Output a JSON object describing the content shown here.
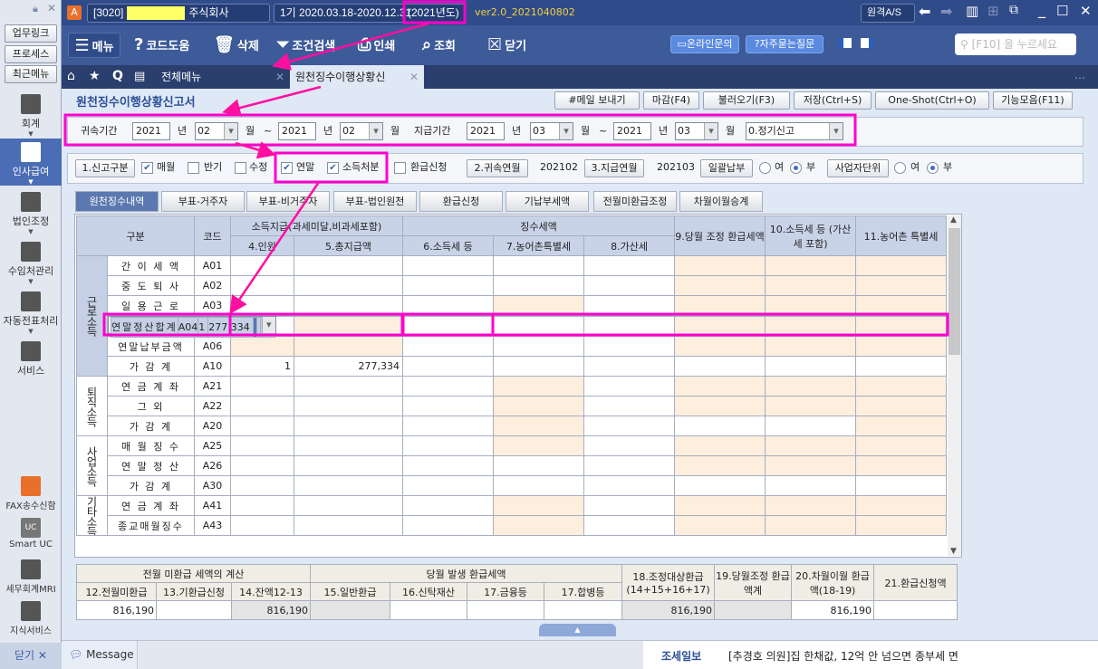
{
  "sidebar": {
    "top_buttons": [
      "업무링크",
      "프로세스",
      "최근메뉴"
    ],
    "menus": [
      {
        "label": "회계",
        "icon": "calculator-icon"
      },
      {
        "label": "인사급여",
        "icon": "person-coins-icon",
        "active": true
      },
      {
        "label": "법인조정",
        "icon": "building-icon"
      },
      {
        "label": "수임처관리",
        "icon": "client-building-icon"
      },
      {
        "label": "자동전표처리",
        "icon": "database-icon"
      },
      {
        "label": "서비스",
        "icon": "monitor-icon"
      }
    ],
    "bottom": [
      {
        "label": "FAX송수신함",
        "icon": "fax-icon"
      },
      {
        "label": "Smart UC",
        "icon": "uc-chat-icon"
      },
      {
        "label": "세무회계MRI",
        "icon": "pulse-chart-icon"
      },
      {
        "label": "지식서비스",
        "icon": "book-icon"
      }
    ],
    "close_label": "닫기"
  },
  "titlebar": {
    "company_code": "[3020]",
    "company_suffix": "주식회사",
    "period": "1기  2020.03.18-2020.12.31",
    "year": "(2021년도)",
    "version": "ver2.0_2021040802",
    "remote_as": "원격A/S"
  },
  "toolbar": {
    "items": [
      "메뉴",
      "코드도움",
      "삭제",
      "조건검색",
      "인쇄",
      "조회",
      "닫기"
    ],
    "online_inquiry": "온라인문의",
    "faq": "자주묻는질문",
    "search_placeholder": "[F10] 을 누르세요"
  },
  "tabs": {
    "all_menu": "전체메뉴",
    "current": "원천징수이행상황신"
  },
  "page": {
    "title": "원천징수이행상황신고서",
    "actions": [
      "#메일 보내기",
      "마감(F4)",
      "불러오기(F3)",
      "저장(Ctrl+S)",
      "One-Shot(Ctrl+O)",
      "기능모음(F11)"
    ]
  },
  "filter": {
    "attr_label": "귀속기간",
    "pay_label": "지급기간",
    "year_unit": "년",
    "month_unit": "월",
    "tilde": "~",
    "attr_from_year": "2021",
    "attr_from_month": "02",
    "attr_to_year": "2021",
    "attr_to_month": "02",
    "pay_from_year": "2021",
    "pay_from_month": "03",
    "pay_to_year": "2021",
    "pay_to_month": "03",
    "report_type": "0.정기신고"
  },
  "options": {
    "report_kind_btn": "1.신고구분",
    "monthly": "매월",
    "half": "반기",
    "amend": "수정",
    "yearend": "연말",
    "income_disp": "소득처분",
    "refund": "환급신청",
    "attr_ym_btn": "2.귀속연월",
    "attr_ym": "202102",
    "pay_ym_btn": "3.지급연월",
    "pay_ym": "202103",
    "lump_btn": "일괄납부",
    "unit_btn": "사업자단위",
    "yes": "여",
    "no": "부"
  },
  "subtabs": [
    "원천징수내역",
    "부표-거주자",
    "부표-비거주자",
    "부표-법인원천",
    "환급신청",
    "기납부세액",
    "전월미환급조정",
    "차월이월승계"
  ],
  "grid": {
    "headers": {
      "category": "구분",
      "code": "코드",
      "income_group": "소득지급(과세미달,비과세포함)",
      "tax_group": "징수세액",
      "c4": "4.인원",
      "c5": "5.총지급액",
      "c6": "6.소득세 등",
      "c7": "7.농어촌특별세",
      "c8": "8.가산세",
      "c9": "9.당월 조정 환급세액",
      "c10": "10.소득세 등 (가산세 포함)",
      "c11": "11.농어촌 특별세"
    },
    "groups": [
      {
        "label": "근로소득",
        "rows": 7
      },
      {
        "label": "퇴직소득",
        "rows": 3
      },
      {
        "label": "사업소득",
        "rows": 3
      },
      {
        "label": "기타소득",
        "rows": 2
      }
    ],
    "rows": [
      {
        "name": "간 이 세 액",
        "code": "A01",
        "c4": "",
        "c5": ""
      },
      {
        "name": "중 도 퇴 사",
        "code": "A02",
        "c4": "",
        "c5": ""
      },
      {
        "name": "일 용 근 로",
        "code": "A03",
        "c4": "",
        "c5": ""
      },
      {
        "name": "연말정산합계",
        "code": "A04",
        "c4": "1",
        "c5": "277,334",
        "selected": true
      },
      {
        "name": "연말분납금액",
        "code": "A05",
        "c4": "",
        "c5": ""
      },
      {
        "name": "연말납부금액",
        "code": "A06",
        "c4": "",
        "c5": ""
      },
      {
        "name": "가  감  계",
        "code": "A10",
        "c4": "1",
        "c5": "277,334"
      },
      {
        "name": "연 금 계 좌",
        "code": "A21",
        "c4": "",
        "c5": ""
      },
      {
        "name": "그 외",
        "code": "A22",
        "c4": "",
        "c5": ""
      },
      {
        "name": "가 감 계",
        "code": "A20",
        "c4": "",
        "c5": ""
      },
      {
        "name": "매 월 징 수",
        "code": "A25",
        "c4": "",
        "c5": ""
      },
      {
        "name": "연 말 정 산",
        "code": "A26",
        "c4": "",
        "c5": ""
      },
      {
        "name": "가  감  계",
        "code": "A30",
        "c4": "",
        "c5": ""
      },
      {
        "name": "연 금 계 좌",
        "code": "A41",
        "c4": "",
        "c5": ""
      },
      {
        "name": "종교매월징수",
        "code": "A43",
        "c4": "",
        "c5": ""
      }
    ]
  },
  "refund": {
    "h_prev": "전월 미환급 세액의 계산",
    "h_curr": "당월 발생 환급세액",
    "h18": "18.조정대상환급 (14+15+16+17)",
    "h19": "19.당월조정 환급액계",
    "h20": "20.차월이월 환급액(18-19)",
    "h21": "21.환급신청액",
    "cols": [
      "12.전월미환급",
      "13.기환급신청",
      "14.잔액12-13",
      "15.일반환급",
      "16.신탁재산",
      "17.금융등",
      "17.합병등"
    ],
    "values": [
      "816,190",
      "",
      "816,190",
      "",
      "",
      "",
      "",
      "816,190",
      "",
      "816,190",
      ""
    ]
  },
  "status": {
    "message": "Message",
    "news_source": "조세일보",
    "news": "[추경호 의원]집 한채값, 12억 안 넘으면 종부세 면"
  },
  "colors": {
    "annotation": "#ff00cc",
    "accent": "#3d5a99",
    "shaded": "#fdeedd",
    "selected_row": "#c5d0e6"
  }
}
